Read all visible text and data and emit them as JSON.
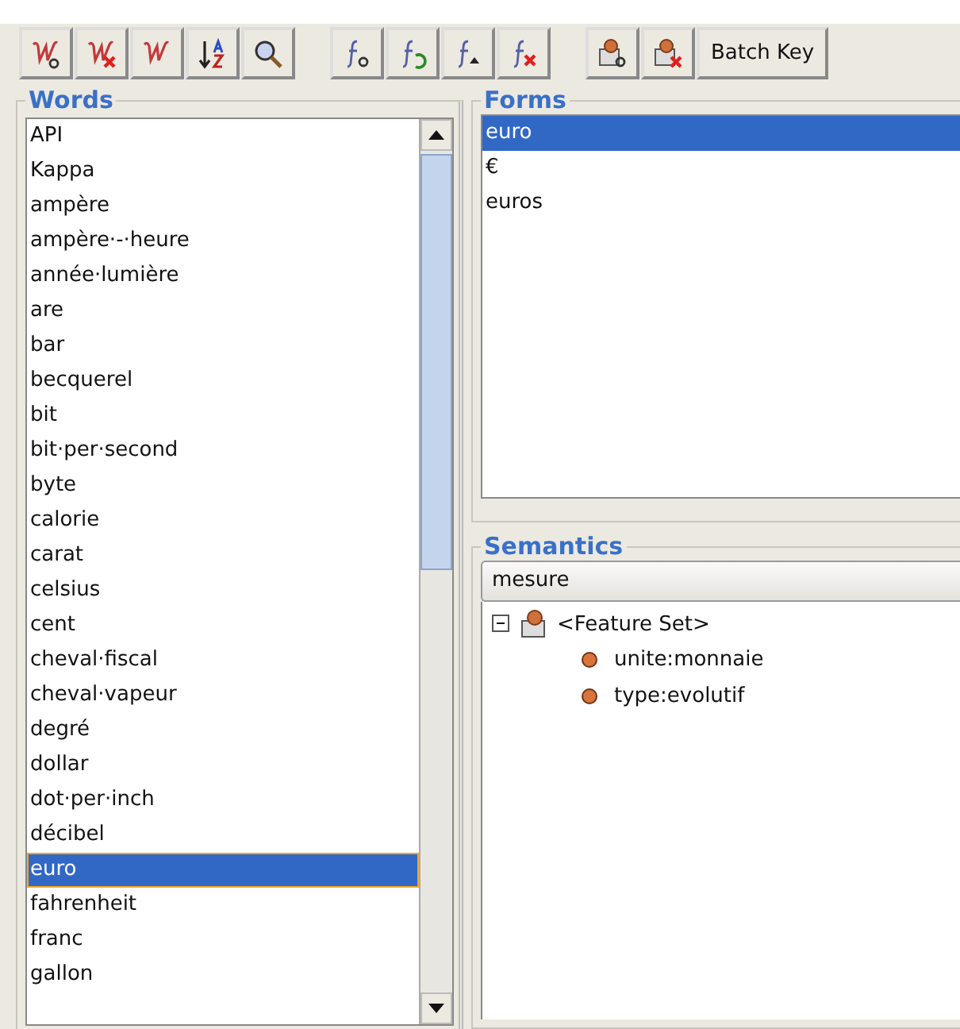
{
  "toolbar": {
    "batch_button": "Batch Key"
  },
  "words": {
    "title": "Words",
    "items": [
      {
        "label": "API",
        "selected": false
      },
      {
        "label": "Kappa",
        "selected": false
      },
      {
        "label": "ampère",
        "selected": false
      },
      {
        "label": "ampère·-·heure",
        "selected": false
      },
      {
        "label": "année·lumière",
        "selected": false
      },
      {
        "label": "are",
        "selected": false
      },
      {
        "label": "bar",
        "selected": false
      },
      {
        "label": "becquerel",
        "selected": false
      },
      {
        "label": "bit",
        "selected": false
      },
      {
        "label": "bit·per·second",
        "selected": false
      },
      {
        "label": "byte",
        "selected": false
      },
      {
        "label": "calorie",
        "selected": false
      },
      {
        "label": "carat",
        "selected": false
      },
      {
        "label": "celsius",
        "selected": false
      },
      {
        "label": "cent",
        "selected": false
      },
      {
        "label": "cheval·fiscal",
        "selected": false
      },
      {
        "label": "cheval·vapeur",
        "selected": false
      },
      {
        "label": "degré",
        "selected": false
      },
      {
        "label": "dollar",
        "selected": false
      },
      {
        "label": "dot·per·inch",
        "selected": false
      },
      {
        "label": "décibel",
        "selected": false
      },
      {
        "label": "euro",
        "selected": true
      },
      {
        "label": "fahrenheit",
        "selected": false
      },
      {
        "label": "franc",
        "selected": false
      },
      {
        "label": "gallon",
        "selected": false
      }
    ]
  },
  "forms": {
    "title": "Forms",
    "items": [
      {
        "label": "euro",
        "selected": true
      },
      {
        "label": "€",
        "selected": false
      },
      {
        "label": "euros",
        "selected": false
      }
    ]
  },
  "semantics": {
    "title": "Semantics",
    "dropdown": "mesure",
    "tree": [
      {
        "label": "<Feature Set>",
        "expanded": true,
        "children": [
          {
            "label": "unite:monnaie"
          },
          {
            "label": "type:evolutif"
          }
        ]
      }
    ]
  }
}
